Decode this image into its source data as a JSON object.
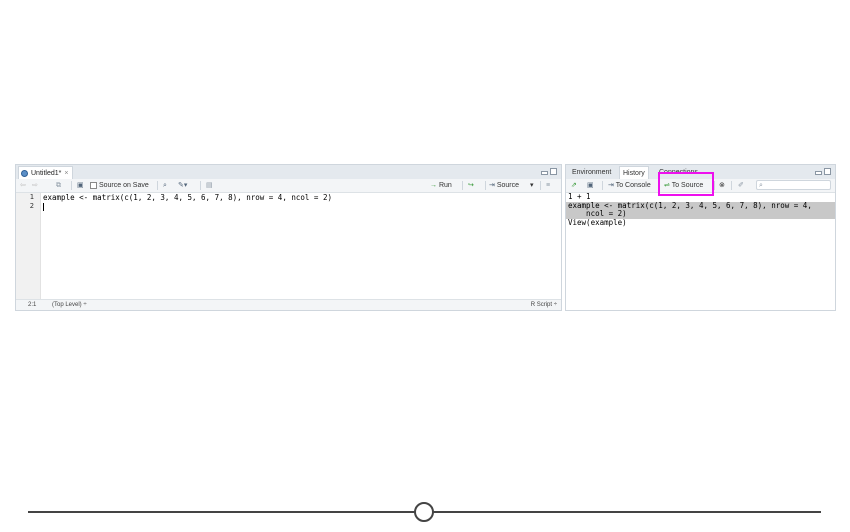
{
  "source": {
    "tab_title": "Untitled1*",
    "tab_close": "×",
    "toolbar": {
      "source_on_save": "Source on Save",
      "run": "Run",
      "source": "Source",
      "dropdown": "▾"
    },
    "gutter": [
      "1",
      "2"
    ],
    "code_lines": [
      "example <- matrix(c(1, 2, 3, 4, 5, 6, 7, 8), nrow = 4, ncol = 2)",
      ""
    ],
    "status": {
      "position": "2:1",
      "scope": "(Top Level) ÷",
      "file_type": "R Script ÷"
    }
  },
  "history_pane": {
    "tabs": [
      "Environment",
      "History",
      "Connections"
    ],
    "active_tab": "History",
    "toolbar": {
      "to_console": "To Console",
      "to_source": "To Source"
    },
    "search_icon": "magnifier-icon",
    "entries": [
      "1 + 1",
      "example <- matrix(c(1, 2, 3, 4, 5, 6, 7, 8), nrow = 4,",
      "    ncol = 2)",
      "View(example)"
    ]
  },
  "highlight_color": "#ee10ee",
  "accent_green": "#3a9a3a"
}
